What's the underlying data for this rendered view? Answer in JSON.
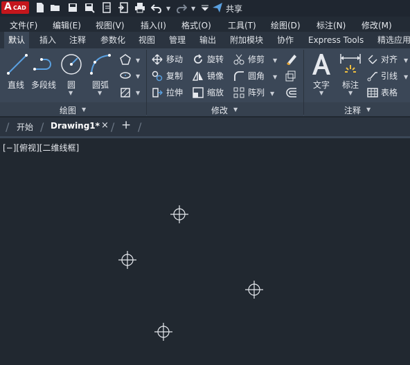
{
  "app": {
    "logo_text": "A",
    "logo_sub": "CAD",
    "share_label": "共享"
  },
  "menu": [
    "文件(F)",
    "编辑(E)",
    "视图(V)",
    "插入(I)",
    "格式(O)",
    "工具(T)",
    "绘图(D)",
    "标注(N)",
    "修改(M)"
  ],
  "ribbon_tabs": [
    "默认",
    "插入",
    "注释",
    "参数化",
    "视图",
    "管理",
    "输出",
    "附加模块",
    "协作",
    "Express Tools",
    "精选应用"
  ],
  "active_tab": "默认",
  "draw_panel": {
    "title": "绘图",
    "tools": [
      "直线",
      "多段线",
      "圆",
      "圆弧"
    ]
  },
  "modify_panel": {
    "title": "修改",
    "tools": [
      "移动",
      "旋转",
      "修剪",
      "复制",
      "镜像",
      "圆角",
      "拉伸",
      "缩放",
      "阵列"
    ]
  },
  "annotation_panel": {
    "title": "注释",
    "big_tools": [
      "文字",
      "标注"
    ],
    "small_tools": [
      "对齐",
      "引线",
      "表格"
    ]
  },
  "doc_tabs": {
    "start": "开始",
    "drawing": "Drawing1*",
    "close": "×",
    "add": "+"
  },
  "viewport": {
    "label": "[−][俯视][二维线框]"
  },
  "colors": {
    "canvas": "#212830",
    "ribbon": "#3b4757",
    "accent_blue": "#5aa0e0",
    "logo_red": "#c4161c"
  }
}
